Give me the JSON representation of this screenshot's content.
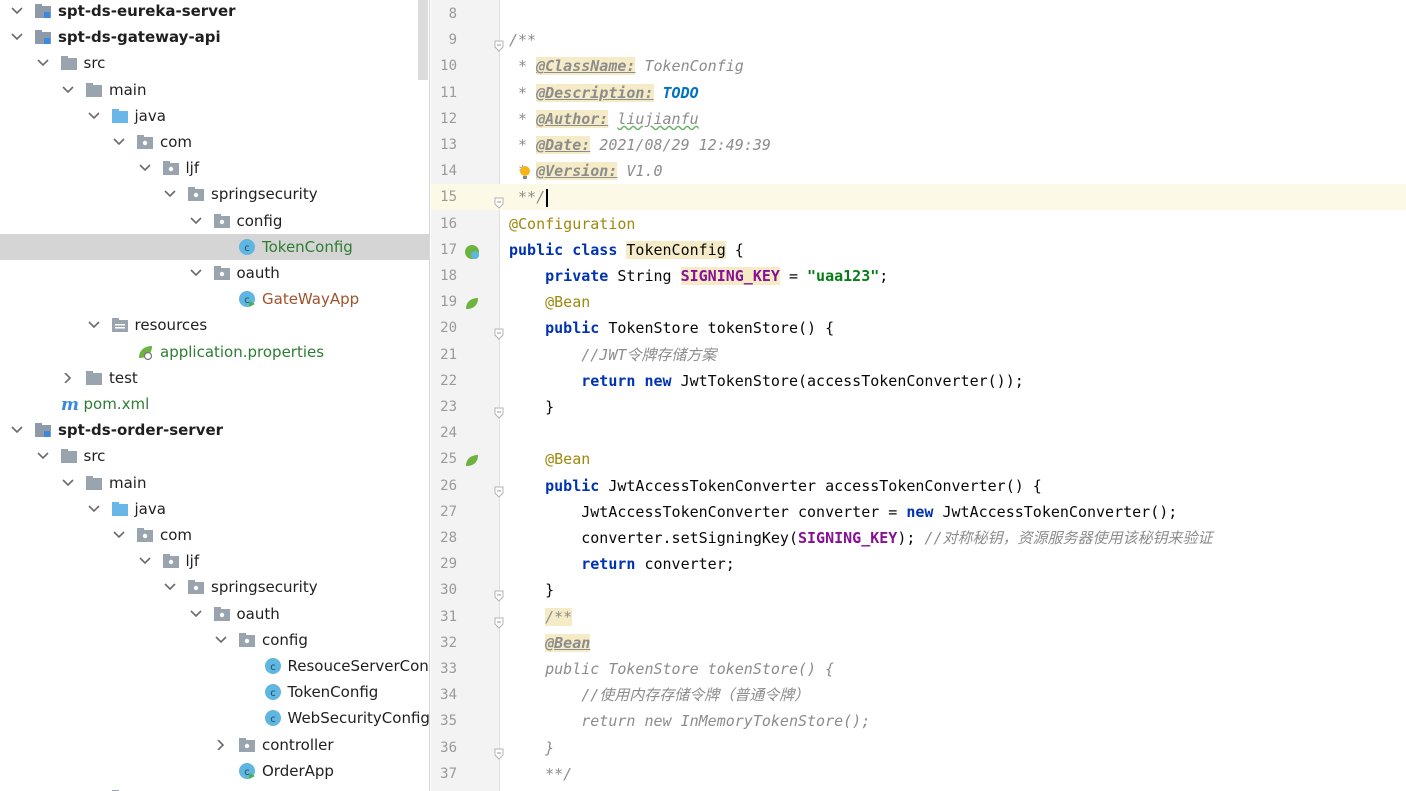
{
  "project_tree": {
    "items": [
      {
        "label": "spt-ds-eureka-server",
        "depth": 0,
        "expanded": true,
        "icon": "module-folder-icon",
        "style": "bold"
      },
      {
        "label": "spt-ds-gateway-api",
        "depth": 0,
        "expanded": true,
        "icon": "module-folder-icon",
        "style": "bold"
      },
      {
        "label": "src",
        "depth": 1,
        "expanded": true,
        "icon": "folder-icon"
      },
      {
        "label": "main",
        "depth": 2,
        "expanded": true,
        "icon": "folder-icon"
      },
      {
        "label": "java",
        "depth": 3,
        "expanded": true,
        "icon": "source-folder-icon"
      },
      {
        "label": "com",
        "depth": 4,
        "expanded": true,
        "icon": "package-icon"
      },
      {
        "label": "ljf",
        "depth": 5,
        "expanded": true,
        "icon": "package-icon"
      },
      {
        "label": "springsecurity",
        "depth": 6,
        "expanded": true,
        "icon": "package-icon"
      },
      {
        "label": "config",
        "depth": 7,
        "expanded": true,
        "icon": "package-icon"
      },
      {
        "label": "TokenConfig",
        "depth": 8,
        "icon": "class-icon",
        "style": "green",
        "selected": true
      },
      {
        "label": "oauth",
        "depth": 7,
        "expanded": true,
        "icon": "package-icon"
      },
      {
        "label": "GateWayApp",
        "depth": 8,
        "icon": "app-class-icon",
        "style": "red"
      },
      {
        "label": "resources",
        "depth": 3,
        "expanded": true,
        "icon": "resources-folder-icon"
      },
      {
        "label": "application.properties",
        "depth": 4,
        "icon": "spring-properties-icon",
        "style": "green"
      },
      {
        "label": "test",
        "depth": 2,
        "expanded": false,
        "icon": "folder-icon"
      },
      {
        "label": "pom.xml",
        "depth": 1,
        "icon": "maven-icon",
        "style": "green"
      },
      {
        "label": "spt-ds-order-server",
        "depth": 0,
        "expanded": true,
        "icon": "module-folder-icon",
        "style": "bold"
      },
      {
        "label": "src",
        "depth": 1,
        "expanded": true,
        "icon": "folder-icon"
      },
      {
        "label": "main",
        "depth": 2,
        "expanded": true,
        "icon": "folder-icon"
      },
      {
        "label": "java",
        "depth": 3,
        "expanded": true,
        "icon": "source-folder-icon"
      },
      {
        "label": "com",
        "depth": 4,
        "expanded": true,
        "icon": "package-icon"
      },
      {
        "label": "ljf",
        "depth": 5,
        "expanded": true,
        "icon": "package-icon"
      },
      {
        "label": "springsecurity",
        "depth": 6,
        "expanded": true,
        "icon": "package-icon"
      },
      {
        "label": "oauth",
        "depth": 7,
        "expanded": true,
        "icon": "package-icon"
      },
      {
        "label": "config",
        "depth": 8,
        "expanded": true,
        "icon": "package-icon"
      },
      {
        "label": "ResouceServerConfig",
        "depth": 9,
        "icon": "class-icon"
      },
      {
        "label": "TokenConfig",
        "depth": 9,
        "icon": "class-icon"
      },
      {
        "label": "WebSecurityConfig",
        "depth": 9,
        "icon": "class-icon"
      },
      {
        "label": "controller",
        "depth": 8,
        "expanded": false,
        "icon": "package-icon"
      },
      {
        "label": "OrderApp",
        "depth": 8,
        "icon": "app-class-icon"
      },
      {
        "label": "resources",
        "depth": 3,
        "expanded": true,
        "icon": "resources-folder-icon"
      }
    ]
  },
  "editor": {
    "current_line": 15,
    "lines": [
      {
        "n": 8,
        "tokens": []
      },
      {
        "n": 9,
        "fold": true,
        "tokens": [
          {
            "t": "/**",
            "c": "cmt"
          }
        ]
      },
      {
        "n": 10,
        "tokens": [
          {
            "t": " * ",
            "c": "cmt"
          },
          {
            "t": "@ClassName:",
            "c": "tag"
          },
          {
            "t": " TokenConfig",
            "c": "cmt"
          }
        ]
      },
      {
        "n": 11,
        "tokens": [
          {
            "t": " * ",
            "c": "cmt"
          },
          {
            "t": "@Description:",
            "c": "tag"
          },
          {
            "t": " ",
            "c": "cmt"
          },
          {
            "t": "TODO",
            "c": "todo"
          }
        ]
      },
      {
        "n": 12,
        "tokens": [
          {
            "t": " * ",
            "c": "cmt"
          },
          {
            "t": "@Author:",
            "c": "tag"
          },
          {
            "t": " ",
            "c": "cmt"
          },
          {
            "t": "liujianfu",
            "c": "cmt wavy"
          }
        ]
      },
      {
        "n": 13,
        "tokens": [
          {
            "t": " * ",
            "c": "cmt"
          },
          {
            "t": "@Date:",
            "c": "tag"
          },
          {
            "t": " 2021/08/29 12:49:39",
            "c": "cmt"
          }
        ]
      },
      {
        "n": 14,
        "bulb": true,
        "tokens": [
          {
            "t": " * ",
            "c": "cmt"
          },
          {
            "t": "@Version:",
            "c": "tag"
          },
          {
            "t": " V1.0",
            "c": "cmt"
          }
        ]
      },
      {
        "n": 15,
        "fold": true,
        "caret": true,
        "tokens": [
          {
            "t": " **/",
            "c": "cmt"
          }
        ]
      },
      {
        "n": 16,
        "tokens": [
          {
            "t": "@Configuration",
            "c": "ann"
          }
        ]
      },
      {
        "n": 17,
        "mark": "bean-class-gutter-icon",
        "tokens": [
          {
            "t": "public class ",
            "c": "kw"
          },
          {
            "t": "TokenConfig",
            "c": "hl"
          },
          {
            "t": " {",
            "c": ""
          }
        ]
      },
      {
        "n": 18,
        "tokens": [
          {
            "t": "    private ",
            "c": "kw"
          },
          {
            "t": "String ",
            "c": ""
          },
          {
            "t": "SIGNING_KEY",
            "c": "field hl"
          },
          {
            "t": " = ",
            "c": ""
          },
          {
            "t": "\"uaa123\"",
            "c": "str"
          },
          {
            "t": ";",
            "c": ""
          }
        ]
      },
      {
        "n": 19,
        "mark": "bean-gutter-icon",
        "tokens": [
          {
            "t": "    @Bean",
            "c": "ann"
          }
        ]
      },
      {
        "n": 20,
        "fold": true,
        "tokens": [
          {
            "t": "    public ",
            "c": "kw"
          },
          {
            "t": "TokenStore tokenStore() {",
            "c": ""
          }
        ]
      },
      {
        "n": 21,
        "tokens": [
          {
            "t": "        //JWT令牌存储方案",
            "c": "cmt"
          }
        ]
      },
      {
        "n": 22,
        "tokens": [
          {
            "t": "        return new ",
            "c": "kw"
          },
          {
            "t": "JwtTokenStore(accessTokenConverter());",
            "c": ""
          }
        ]
      },
      {
        "n": 23,
        "fold": true,
        "tokens": [
          {
            "t": "    }",
            "c": ""
          }
        ]
      },
      {
        "n": 24,
        "tokens": []
      },
      {
        "n": 25,
        "mark": "bean-gutter-icon",
        "tokens": [
          {
            "t": "    @Bean",
            "c": "ann"
          }
        ]
      },
      {
        "n": 26,
        "fold": true,
        "tokens": [
          {
            "t": "    public ",
            "c": "kw"
          },
          {
            "t": "JwtAccessTokenConverter accessTokenConverter() {",
            "c": ""
          }
        ]
      },
      {
        "n": 27,
        "tokens": [
          {
            "t": "        JwtAccessTokenConverter converter = ",
            "c": ""
          },
          {
            "t": "new ",
            "c": "kw"
          },
          {
            "t": "JwtAccessTokenConverter();",
            "c": ""
          }
        ]
      },
      {
        "n": 28,
        "tokens": [
          {
            "t": "        converter.setSigningKey(",
            "c": ""
          },
          {
            "t": "SIGNING_KEY",
            "c": "field"
          },
          {
            "t": "); ",
            "c": ""
          },
          {
            "t": "//对称秘钥，资源服务器使用该秘钥来验证",
            "c": "cmt"
          }
        ]
      },
      {
        "n": 29,
        "tokens": [
          {
            "t": "        return ",
            "c": "kw"
          },
          {
            "t": "converter;",
            "c": ""
          }
        ]
      },
      {
        "n": 30,
        "fold": true,
        "tokens": [
          {
            "t": "    }",
            "c": ""
          }
        ]
      },
      {
        "n": 31,
        "fold": true,
        "tokens": [
          {
            "t": "    ",
            "c": ""
          },
          {
            "t": "/**",
            "c": "cmt hl"
          }
        ]
      },
      {
        "n": 32,
        "tokens": [
          {
            "t": "    ",
            "c": ""
          },
          {
            "t": "@Bean",
            "c": "tag"
          }
        ]
      },
      {
        "n": 33,
        "tokens": [
          {
            "t": "    public TokenStore tokenStore() {",
            "c": "dead"
          }
        ]
      },
      {
        "n": 34,
        "tokens": [
          {
            "t": "        //使用内存存储令牌（普通令牌）",
            "c": "dead"
          }
        ]
      },
      {
        "n": 35,
        "tokens": [
          {
            "t": "        return new InMemoryTokenStore();",
            "c": "dead"
          }
        ]
      },
      {
        "n": 36,
        "fold": true,
        "tokens": [
          {
            "t": "    }",
            "c": "dead"
          }
        ]
      },
      {
        "n": 37,
        "tokens": [
          {
            "t": "    **/",
            "c": "dead"
          }
        ]
      }
    ]
  },
  "colors": {
    "selection": "#d5d5d5",
    "keyword": "#0033b3",
    "string": "#067d17",
    "field": "#871094",
    "annotation": "#9e880d",
    "comment": "#8c8c8c",
    "todo": "#0073bf",
    "current_line": "#fcfae6"
  }
}
